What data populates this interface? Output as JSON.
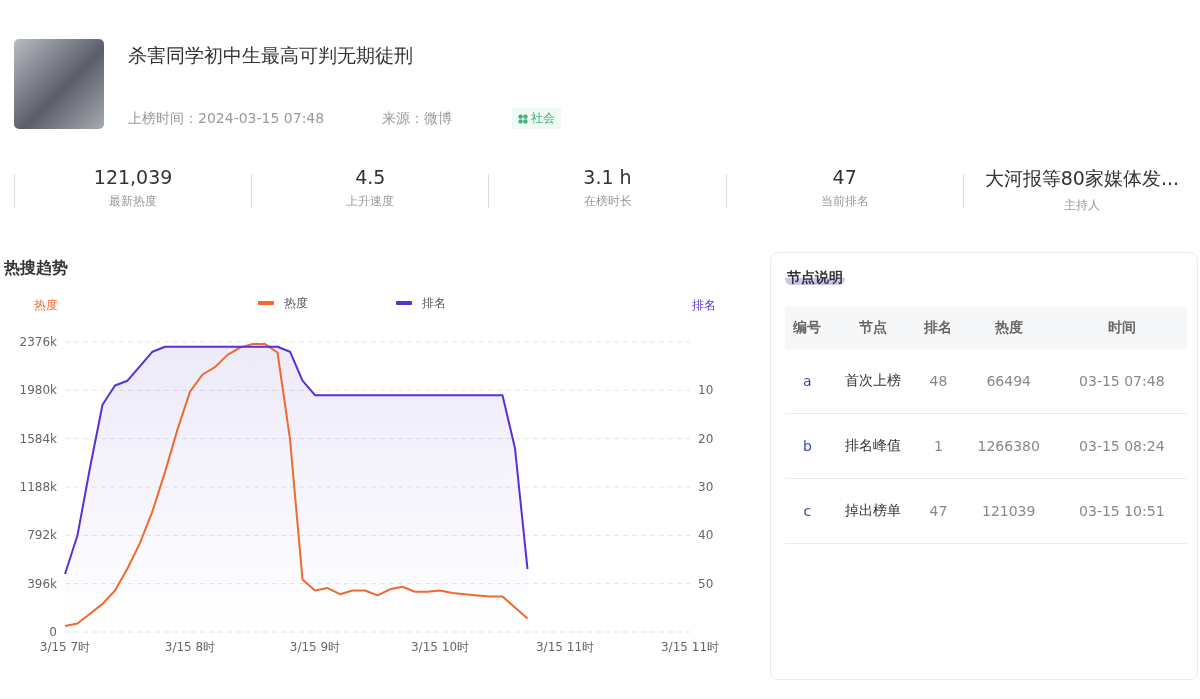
{
  "topic": {
    "title": "杀害同学初中生最高可判无期徒刑",
    "meta": [
      "上榜时间：2024-03-15 07:48",
      "来源：微博"
    ],
    "tag": "社会"
  },
  "stats": [
    {
      "value": "121,039",
      "label": "最新热度"
    },
    {
      "value": "4.5",
      "label": "上升速度"
    },
    {
      "value": "3.1 h",
      "label": "在榜时长"
    },
    {
      "value": "47",
      "label": "当前排名"
    },
    {
      "value": "大河报等80家媒体发...",
      "label": "主持人"
    }
  ],
  "trend": {
    "title": "热搜趋势",
    "chart_data": {
      "type": "line",
      "grid": true,
      "legend": "top",
      "ylabel": "热度",
      "y2label": "排名",
      "categories": [
        "3/15 7时",
        null,
        null,
        null,
        null,
        null,
        null,
        null,
        null,
        null,
        "3/15 8时",
        null,
        null,
        null,
        null,
        null,
        null,
        null,
        null,
        null,
        "3/15 9时",
        null,
        null,
        null,
        null,
        null,
        null,
        null,
        null,
        null,
        "3/15 10时",
        null,
        null,
        null,
        null,
        null,
        null,
        null,
        null,
        null,
        "3/15 11时",
        null,
        null,
        null,
        null,
        null,
        null,
        null,
        null,
        null,
        "3/15 11时"
      ],
      "series": [
        {
          "name": "热度",
          "color": "#ee6a2f",
          "values": [
            50,
            70,
            150,
            230,
            340,
            520,
            730,
            990,
            1310,
            1660,
            1970,
            2110,
            2170,
            2270,
            2330,
            2360,
            2360,
            2290,
            1580,
            430,
            340,
            360,
            310,
            340,
            340,
            300,
            350,
            370,
            330,
            330,
            340,
            320,
            310,
            300,
            290,
            290,
            200,
            110,
            null,
            null,
            null,
            null,
            null,
            null,
            null,
            null,
            null,
            null,
            null,
            null,
            null
          ]
        },
        {
          "name": "排名",
          "color": "#5b2fd6",
          "axis": "y2",
          "values": [
            48,
            40,
            26,
            13,
            9,
            8,
            5,
            2,
            1,
            1,
            1,
            1,
            1,
            1,
            1,
            1,
            1,
            1,
            2,
            8,
            11,
            11,
            11,
            11,
            11,
            11,
            11,
            11,
            11,
            11,
            11,
            11,
            11,
            11,
            11,
            11,
            22,
            47,
            null,
            null,
            null,
            null,
            null,
            null,
            null,
            null,
            null,
            null,
            null,
            null,
            null
          ]
        }
      ],
      "ylim": [
        0,
        2376
      ],
      "y2lim": [
        60,
        0
      ],
      "yticks": [
        {
          "value": 0,
          "label": "0"
        },
        {
          "value": 396,
          "label": "396k"
        },
        {
          "value": 792,
          "label": "792k"
        },
        {
          "value": 1188,
          "label": "1188k"
        },
        {
          "value": 1584,
          "label": "1584k"
        },
        {
          "value": 1980,
          "label": "1980k"
        },
        {
          "value": 2376,
          "label": "2376k"
        }
      ],
      "y2ticks": [
        10,
        20,
        30,
        40,
        50
      ]
    }
  },
  "nodes": {
    "title": "节点说明",
    "columns": [
      "编号",
      "节点",
      "排名",
      "热度",
      "时间"
    ],
    "rows": [
      [
        "a",
        "首次上榜",
        "48",
        "66494",
        "03-15 07:48"
      ],
      [
        "b",
        "排名峰值",
        "1",
        "1266380",
        "03-15 08:24"
      ],
      [
        "c",
        "掉出榜单",
        "47",
        "121039",
        "03-15 10:51"
      ]
    ]
  }
}
